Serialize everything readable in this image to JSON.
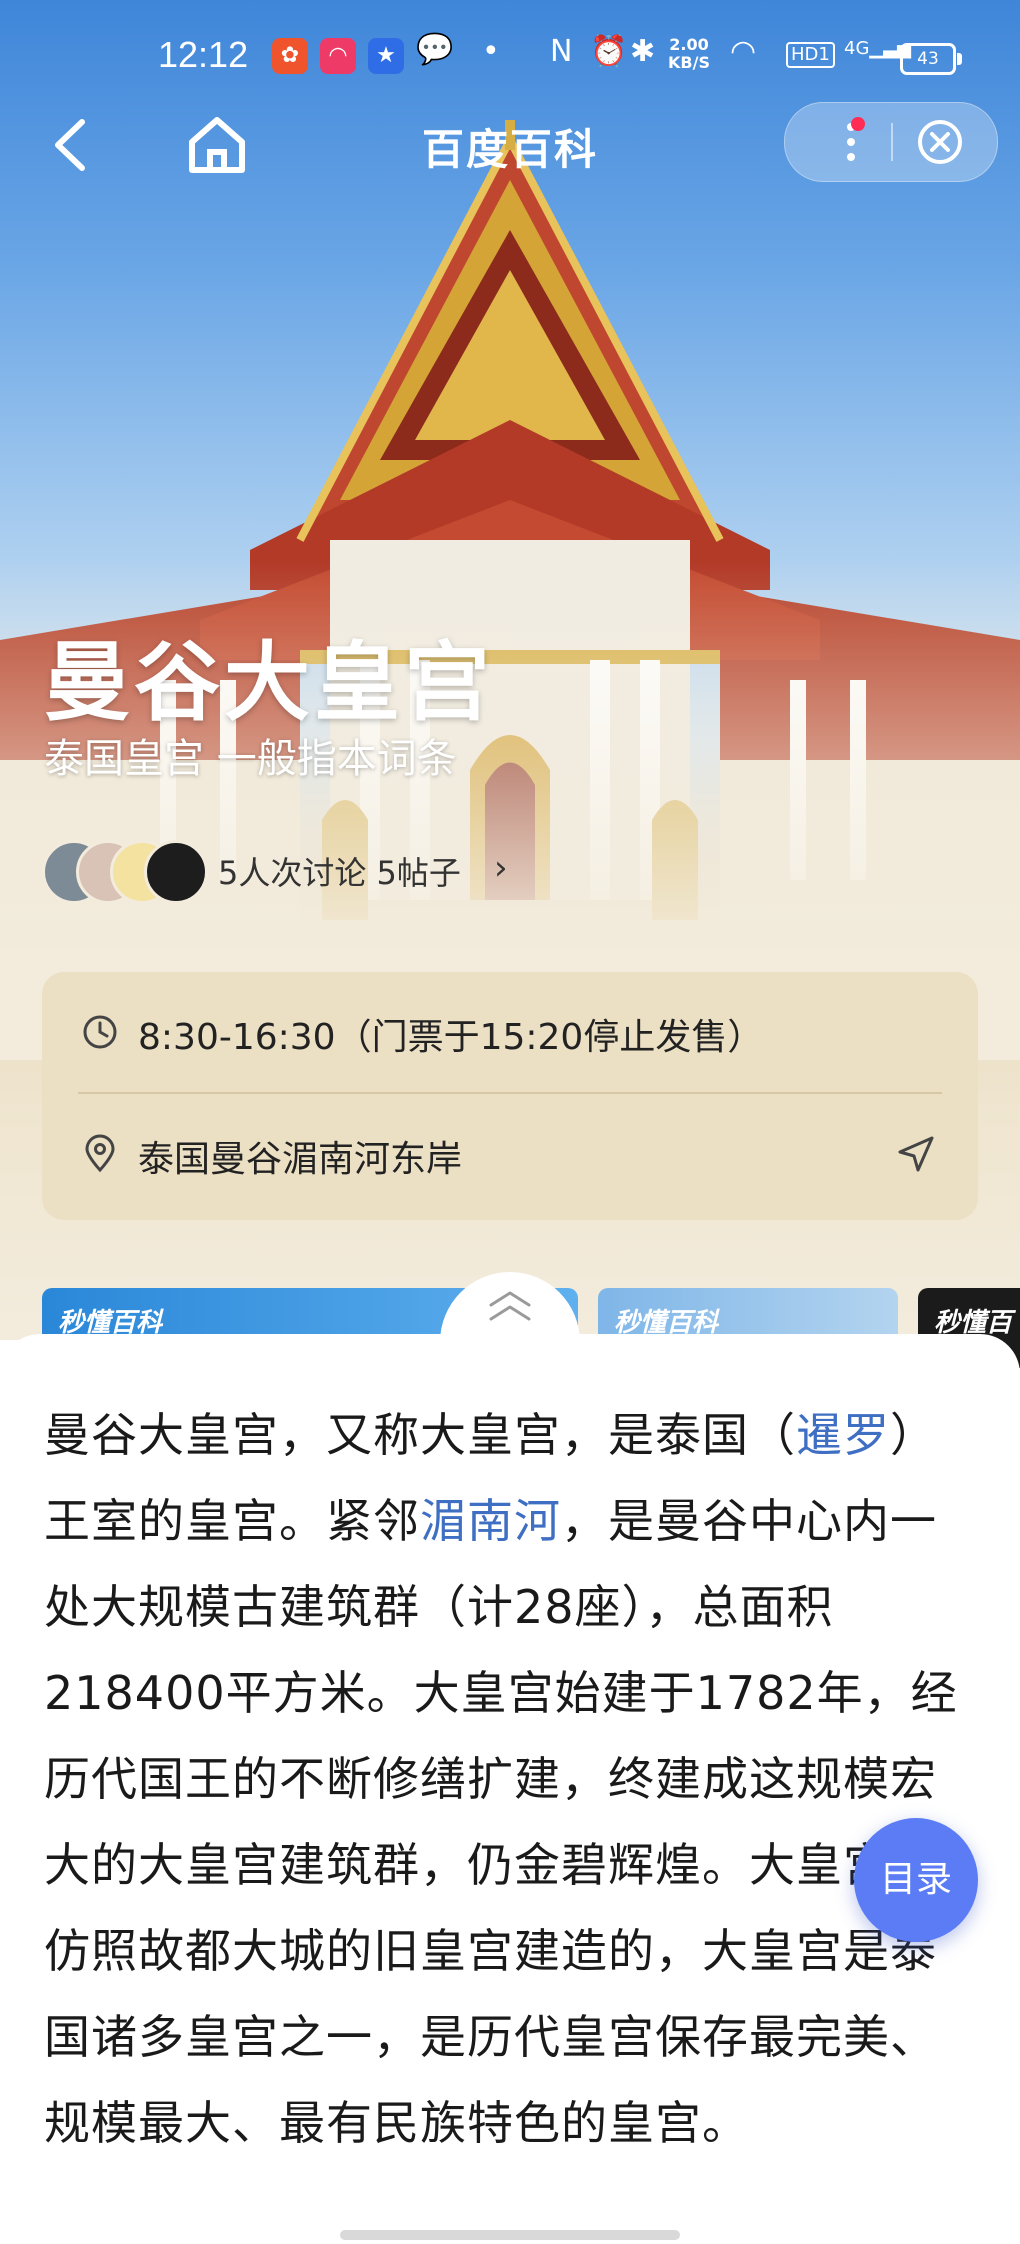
{
  "status_bar": {
    "time": "12:12",
    "network_speed_value": "2.00",
    "network_speed_unit": "KB/S",
    "hd_badge": "HD1",
    "signal_label": "4G",
    "battery": "43",
    "icons": [
      "app-icon-1",
      "app-icon-2",
      "app-icon-3",
      "wechat-icon",
      "dot-icon",
      "nfc-icon",
      "alarm-icon",
      "bluetooth-icon",
      "wifi-icon",
      "signal-icon",
      "battery-icon"
    ]
  },
  "nav": {
    "title": "百度百科"
  },
  "entry": {
    "title": "曼谷大皇宫",
    "subtitle": "泰国皇宫 一般指本词条",
    "discussion": "5人次讨论  5帖子",
    "discussion_arrow": "›"
  },
  "info": {
    "hours": "8:30-16:30（门票于15:20停止发售）",
    "address": "泰国曼谷湄南河东岸"
  },
  "media": {
    "brand": "秒懂百科"
  },
  "article": {
    "p1_a": "曼谷大皇宫，又称大皇宫，是泰国（",
    "link1": "暹罗",
    "p1_b": "）王室的皇宫。紧邻",
    "link2": "湄南河",
    "p1_c": "，是曼谷中心内一处大规模古建筑群（计28座），总面积218400平方米。大皇宫始建于1782年，经历代国王的不断修缮扩建，终建成这规模宏大的大皇宫建筑群，仍金碧辉煌。大皇宫是仿照故都大城的旧皇宫建造的，大皇宫是泰国诸多皇宫之一，是历代皇宫保存最完美、规模最大、最有民族特色的皇宫。"
  },
  "toc_label": "目录",
  "colors": {
    "link": "#3f6fc2",
    "toc": "#5b7cf4",
    "card": "#ebdfc4"
  }
}
